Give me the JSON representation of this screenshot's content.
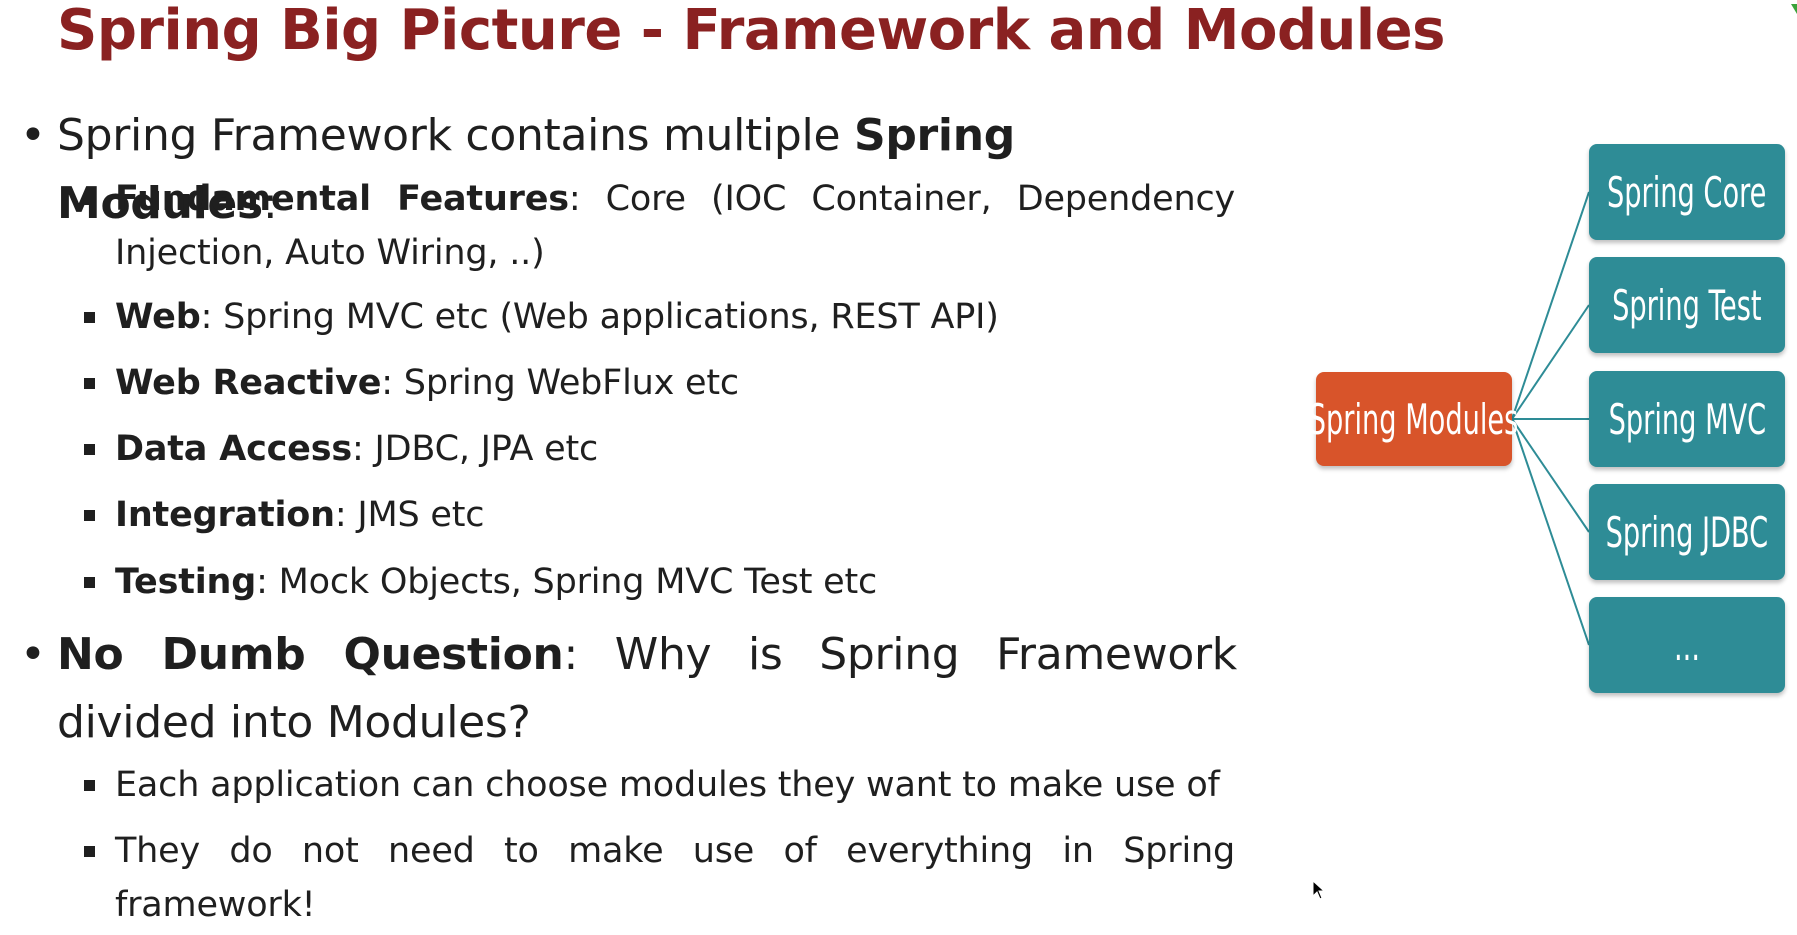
{
  "slide": {
    "title": "Spring Big Picture - Framework and Modules",
    "bullets": {
      "intro": {
        "prefix": "Spring Framework contains multiple ",
        "bold": "Spring Modules",
        "suffix": ":"
      },
      "modules": [
        {
          "label": "Fundamental Features",
          "text": ": Core (IOC Container, Dependency Injection, Auto Wiring, ..)"
        },
        {
          "label": "Web",
          "text": ": Spring MVC etc (Web applications, REST API)"
        },
        {
          "label": "Web Reactive",
          "text": ": Spring WebFlux etc"
        },
        {
          "label": "Data Access",
          "text": ": JDBC, JPA etc"
        },
        {
          "label": "Integration",
          "text": ": JMS etc"
        },
        {
          "label": "Testing",
          "text": ": Mock Objects, Spring MVC Test etc"
        }
      ],
      "question": {
        "bold": "No Dumb Question",
        "text": ": Why is Spring Framework divided into Modules?"
      },
      "answers": [
        "Each application can choose modules they want to make use of",
        "They do not need to make use of everything in Spring framework!"
      ]
    }
  },
  "diagram": {
    "root": "Spring Modules",
    "children": [
      "Spring Core",
      "Spring Test",
      "Spring MVC",
      "Spring JDBC",
      "..."
    ],
    "colors": {
      "root": "#d8542a",
      "child": "#2e8c96",
      "connector": "#2e8c96"
    }
  },
  "colors": {
    "title": "#8a2121",
    "text": "#1f1f1f"
  }
}
